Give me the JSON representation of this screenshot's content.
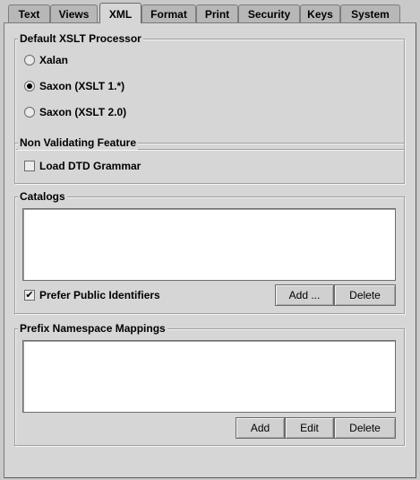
{
  "tabs": [
    {
      "label": "Text"
    },
    {
      "label": "Views"
    },
    {
      "label": "XML"
    },
    {
      "label": "Format"
    },
    {
      "label": "Print"
    },
    {
      "label": "Security"
    },
    {
      "label": "Keys"
    },
    {
      "label": "System"
    }
  ],
  "active_tab": "XML",
  "xslt": {
    "title": "Default XSLT Processor",
    "options": [
      {
        "label": "Xalan",
        "selected": false
      },
      {
        "label": "Saxon (XSLT 1.*)",
        "selected": true
      },
      {
        "label": "Saxon (XSLT 2.0)",
        "selected": false
      }
    ]
  },
  "nonvalidating": {
    "title": "Non Validating Feature",
    "load_dtd_label": "Load DTD Grammar",
    "load_dtd_checked": false
  },
  "catalogs": {
    "title": "Catalogs",
    "items": [],
    "prefer_public_label": "Prefer Public Identifiers",
    "prefer_public_checked": true,
    "add_label": "Add ...",
    "delete_label": "Delete"
  },
  "prefix": {
    "title": "Prefix Namespace Mappings",
    "items": [],
    "add_label": "Add",
    "edit_label": "Edit",
    "delete_label": "Delete"
  },
  "colors": {
    "panel_bg": "#d6d6d6",
    "tab_bg": "#b7b7b7",
    "window_bg": "#c9c9c9"
  }
}
